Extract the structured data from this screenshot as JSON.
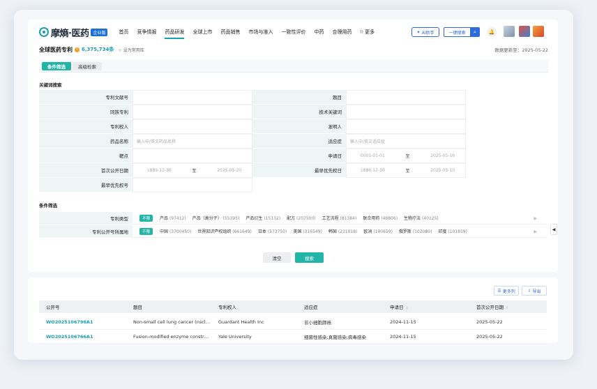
{
  "brand": {
    "name": "摩熵·医药",
    "edition": "企业版"
  },
  "nav": {
    "items": [
      "首页",
      "竞争情报",
      "药品研发",
      "全球上市",
      "药品销售",
      "市场与准入",
      "一致性评价",
      "中药",
      "合理用药",
      "更多"
    ],
    "active_index": 2,
    "ai_label": "AI助手",
    "search_label": "一键搜索"
  },
  "page": {
    "title": "全球医药专利",
    "count": "6,375,734条",
    "favorite": "设为常用库",
    "update": "数据更新至：2025-05-22"
  },
  "tabs": [
    "条件筛选",
    "高级检索"
  ],
  "keyword_section": "关键词搜索",
  "form": {
    "rows": [
      [
        {
          "label": "专利文献号",
          "value": ""
        },
        {
          "label": "题目",
          "value": ""
        }
      ],
      [
        {
          "label": "同族专利",
          "value": ""
        },
        {
          "label": "技术关键词",
          "value": ""
        }
      ],
      [
        {
          "label": "专利权人",
          "value": ""
        },
        {
          "label": "发明人",
          "value": ""
        }
      ],
      [
        {
          "label": "药品名称",
          "placeholder": "输入中/英文药品名称"
        },
        {
          "label": "适应症",
          "placeholder": "输入中/英文适应症"
        }
      ],
      [
        {
          "label": "靶点",
          "value": ""
        },
        {
          "label": "申请日",
          "from": "0001-01-01",
          "to_label": "至",
          "to": "2025-05-16"
        }
      ],
      [
        {
          "label": "首次公开日期",
          "from": "1889-12-30",
          "to_label": "至",
          "to": "2025-05-20"
        },
        {
          "label": "最早优先权日",
          "from": "1886-12-30",
          "to_label": "至",
          "to": "2025-05-10"
        }
      ],
      [
        {
          "label": "最早优先权号",
          "value": ""
        }
      ]
    ]
  },
  "condition_section": "条件筛选",
  "conditions": [
    {
      "label": "专利类型",
      "chip": "不限",
      "options": [
        {
          "name": "产品",
          "count": "(97412)"
        },
        {
          "name": "产品（高分子）",
          "count": "(55395)"
        },
        {
          "name": "产品衍生",
          "count": "(15132)"
        },
        {
          "name": "配方",
          "count": "(207500)"
        },
        {
          "name": "工艺流程",
          "count": "(81384)"
        },
        {
          "name": "联合用药",
          "count": "(48806)"
        },
        {
          "name": "生物疗法",
          "count": "(40125)"
        }
      ]
    },
    {
      "label": "专利公开号所属地",
      "chip": "不限",
      "options": [
        {
          "name": "中国",
          "count": "(3700450)"
        },
        {
          "name": "世界知识产权组织",
          "count": "(661649)"
        },
        {
          "name": "日本",
          "count": "(573750)"
        },
        {
          "name": "美国",
          "count": "(316549)"
        },
        {
          "name": "韩国",
          "count": "(231018)"
        },
        {
          "name": "欧洲",
          "count": "(190659)"
        },
        {
          "name": "俄罗斯",
          "count": "(102080)"
        },
        {
          "name": "印度",
          "count": "(101859)"
        }
      ]
    }
  ],
  "actions": {
    "clear": "清空",
    "search": "搜索"
  },
  "results": {
    "more_columns": "更多列",
    "export": "导出",
    "columns": [
      "公开号",
      "题目",
      "专利权人",
      "适应症",
      "申请日",
      "首次公开日期"
    ],
    "rows": [
      [
        "WO2025106796A1",
        "Non-small cell lung cancer (nscl…",
        "Guardant Health Inc",
        "非小细胞肺癌",
        "2024-11-15",
        "2025-05-22"
      ],
      [
        "WO2025106766A1",
        "Fusion-modified enzyme constr…",
        "Yale University",
        "细菌性感染;真菌感染;病毒感染",
        "2024-11-15",
        "2025-05-22"
      ]
    ]
  },
  "colors": {
    "accent": "#21b4a7",
    "link": "#1a9eb0",
    "blue": "#2d6bdc"
  }
}
